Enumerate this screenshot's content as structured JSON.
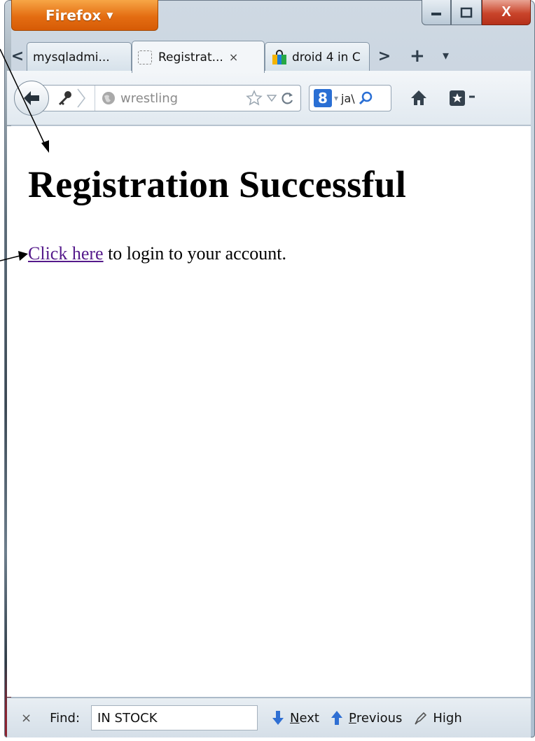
{
  "window": {
    "app_button_label": "Firefox",
    "caption": {
      "minimize": "–",
      "maximize": "☐",
      "close": "X"
    }
  },
  "tabs": [
    {
      "label": "mysqladmi...",
      "active": false
    },
    {
      "label": "Registrat...",
      "active": true,
      "close": "×"
    },
    {
      "label": "droid 4 in C",
      "active": false
    }
  ],
  "tab_controls": {
    "scroll_left": "<",
    "scroll_right": ">",
    "new_tab": "+",
    "list_all": "▾"
  },
  "navbar": {
    "url_text": "wrestling",
    "search_text": "ja\\",
    "search_engine_badge": "8"
  },
  "page": {
    "title": "Registration Successful",
    "link_text": "Click here",
    "line_rest": " to login to your account."
  },
  "findbar": {
    "close": "×",
    "label": "Find:",
    "query": "IN STOCK",
    "next_label": "Next",
    "next_underline": "N",
    "next_rest": "ext",
    "previous_underline": "P",
    "previous_rest": "revious",
    "highlight_label": "High"
  },
  "icons": [
    "back-arrow-icon",
    "key-icon",
    "globe-icon",
    "star-icon",
    "dropdown-triangle-icon",
    "reload-icon",
    "search-magnifier-icon",
    "home-icon",
    "bookmarks-icon",
    "blank-page-icon",
    "shopping-bag-icon",
    "down-arrow-icon",
    "up-arrow-icon",
    "highlighter-icon"
  ],
  "colors": {
    "firefox_orange": "#e46d12",
    "visited_link": "#551a8b",
    "find_arrows": "#2f6fd3",
    "close_red": "#c9442a"
  }
}
